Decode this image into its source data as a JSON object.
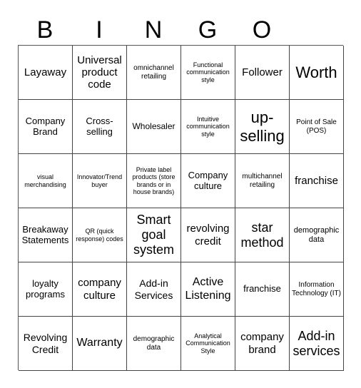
{
  "header": {
    "letters": [
      "B",
      "I",
      "N",
      "G",
      "O"
    ]
  },
  "grid": {
    "rows": [
      [
        "Layaway",
        "Universal product code",
        "omnichannel retailing",
        "Functional communication style",
        "Follower",
        "Worth"
      ],
      [
        "Company Brand",
        "Cross-selling",
        "Wholesaler",
        "Intuitive communication style",
        "up-selling",
        "Point of Sale (POS)"
      ],
      [
        "visual merchandising",
        "Innovator/Trend buyer",
        "Private label products (store brands or in house brands)",
        "Company culture",
        "multichannel retailing",
        "franchise"
      ],
      [
        "Breakaway Statements",
        "QR (quick response) codes",
        "Smart goal system",
        "revolving credit",
        "star method",
        "demographic data"
      ],
      [
        "loyalty programs",
        "company culture",
        "Add-in Services",
        "Active Listening",
        "franchise",
        "Information Technology (IT)"
      ],
      [
        "Revolving Credit",
        "Warranty",
        "demographic data",
        "Analytical Communication Style",
        "company brand",
        "Add-in services"
      ]
    ]
  }
}
